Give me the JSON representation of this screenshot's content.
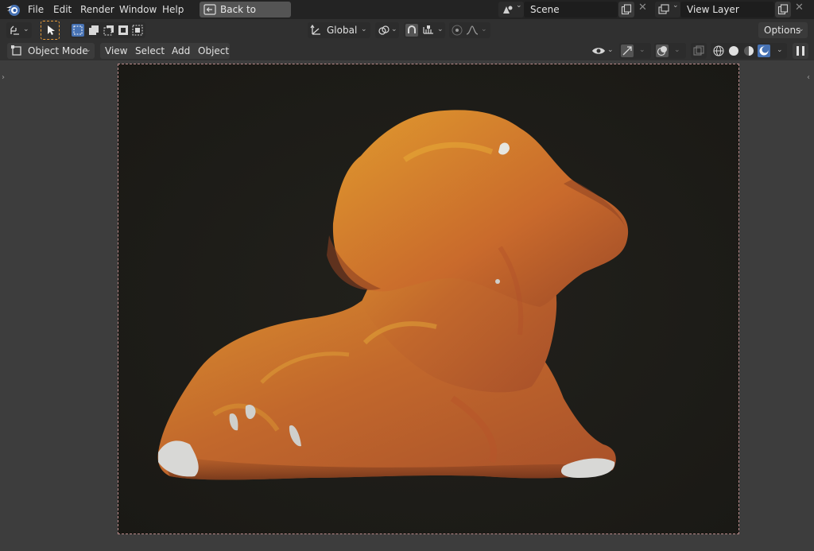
{
  "menubar": {
    "items": [
      "File",
      "Edit",
      "Render",
      "Window",
      "Help"
    ],
    "back_button": "Back to Previous",
    "scene": {
      "label": "Scene"
    },
    "view_layer": {
      "label": "View Layer"
    }
  },
  "toolbar": {
    "transform_orientation": "Global",
    "options_label": "Options"
  },
  "viewport_header": {
    "mode": "Object Mode",
    "menus": [
      "View",
      "Select",
      "Add",
      "Object"
    ]
  },
  "colors": {
    "accent_blue": "#4772b3",
    "topbar_bg": "#232323",
    "header_bg": "#303030",
    "viewport_bg": "#3d3d3d",
    "render_bg": "#1c1b17",
    "camera_border": "#b98a8a",
    "sculpture_orange": "#c9702c"
  },
  "icons": {
    "blender_logo": "blender-logo-icon",
    "back": "back-to-previous-icon",
    "scene": "scene-icon",
    "new": "new-datablock-icon",
    "close": "close-x-icon",
    "view_layer": "view-layer-icon",
    "editor_type": "editor-type-icon",
    "select_tool": "select-box-tool-icon",
    "transform_pivot": "transform-orientation-icon",
    "pivot": "pivot-point-icon",
    "snap": "snap-magnet-icon",
    "proportional": "proportional-edit-icon",
    "visibility": "eye-visibility-icon",
    "gizmo": "gizmo-icon",
    "overlay": "overlay-icon",
    "xray": "xray-icon",
    "shading_wire": "wireframe-shading-icon",
    "shading_solid": "solid-shading-icon",
    "shading_material": "material-shading-icon",
    "shading_rendered": "rendered-shading-icon",
    "pause": "pause-render-icon"
  }
}
